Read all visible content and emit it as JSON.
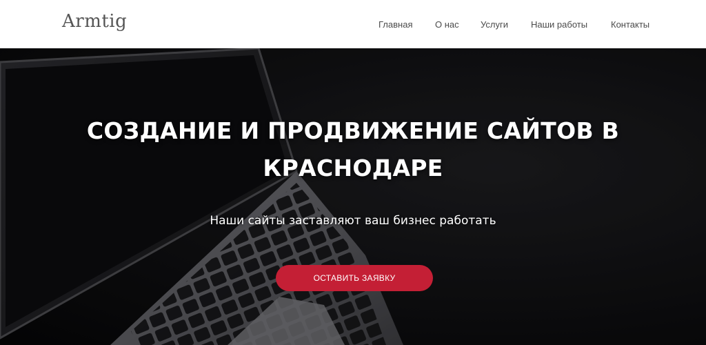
{
  "header": {
    "logo": "Armtig",
    "nav": [
      {
        "label": "Главная"
      },
      {
        "label": "О нас"
      },
      {
        "label": "Услуги"
      },
      {
        "label": "Наши работы"
      },
      {
        "label": "Контакты"
      }
    ]
  },
  "hero": {
    "title_line1": "СОЗДАНИЕ И ПРОДВИЖЕНИЕ САЙТОВ В",
    "title_line2": "КРАСНОДАРЕ",
    "subtitle": "Наши сайты заставляют ваш бизнес работать",
    "cta_label": "ОСТАВИТЬ ЗАЯВКУ",
    "background_image": "laptop-keyboard-icon"
  },
  "colors": {
    "accent": "#c41f35",
    "header_bg": "#ffffff",
    "hero_bg": "#0f0f11",
    "nav_text": "#4a4a4a"
  }
}
